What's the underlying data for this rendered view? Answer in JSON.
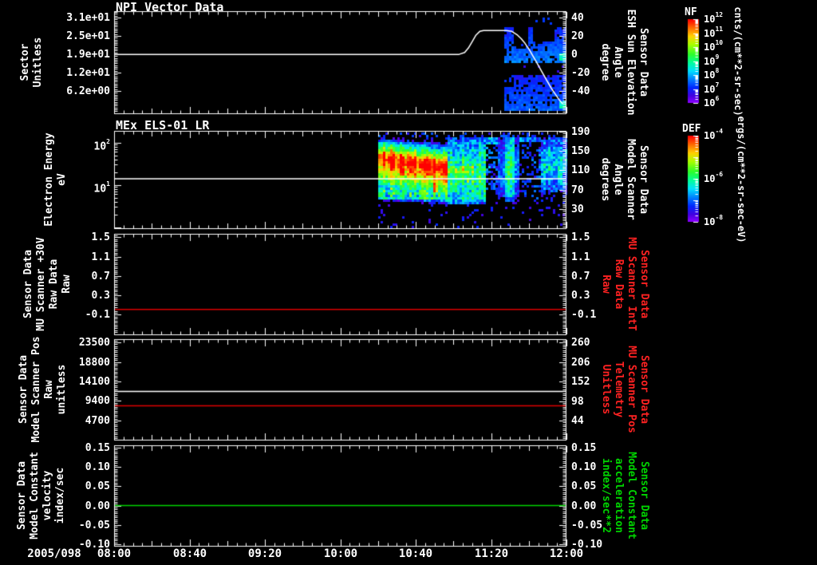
{
  "colors": {
    "background": "#000000",
    "foreground": "#ffffff",
    "red_accent": "#ff2222",
    "green_accent": "#00d400"
  },
  "chart_data": {
    "type": "heatmap",
    "description": "Five stacked time-series panels: NPI sector spectrogram with sun elevation line, MEx ELS-01 LR electron energy spectrogram, and three constant-value line panels",
    "date_label": "2005/098",
    "time_axis": {
      "tick_labels": [
        "08:00",
        "08:40",
        "09:20",
        "10:00",
        "10:40",
        "11:20",
        "12:00"
      ],
      "tick_minutes": [
        0,
        40,
        80,
        120,
        160,
        200,
        240
      ],
      "minor_step_min": 5,
      "mid_step_min": 20,
      "range_min": [
        0,
        240
      ]
    },
    "palette": [
      [
        0.0,
        "#ff0000"
      ],
      [
        0.1,
        "#ff6a00"
      ],
      [
        0.2,
        "#ffd000"
      ],
      [
        0.3,
        "#a8ff00"
      ],
      [
        0.42,
        "#2bff2b"
      ],
      [
        0.52,
        "#00ff99"
      ],
      [
        0.62,
        "#00e0ff"
      ],
      [
        0.72,
        "#0080ff"
      ],
      [
        0.82,
        "#0028ff"
      ],
      [
        0.92,
        "#4400e0"
      ],
      [
        1.0,
        "#8a00ff"
      ]
    ],
    "panels": [
      {
        "id": "npi-vector-data",
        "title": "NPI Vector Data",
        "left_label": "Sector\nUnitless",
        "right_label": "Sensor Data\nESH Sun Elevation\nAngle\ndegree",
        "left_axis": {
          "scale": "linear",
          "ylim": [
            -1.63,
            33.42
          ],
          "minor_step": 0.625,
          "ticks": [
            {
              "v": 31.25,
              "label": "3.1e+01"
            },
            {
              "v": 25.0,
              "label": "2.5e+01"
            },
            {
              "v": 18.75,
              "label": "1.9e+01"
            },
            {
              "v": 12.5,
              "label": "1.2e+01"
            },
            {
              "v": 6.25,
              "label": "6.2e+00"
            }
          ]
        },
        "right_axis": {
          "scale": "linear",
          "ylim": [
            -65,
            47
          ],
          "minor_step": 2,
          "ticks": [
            {
              "v": 40,
              "label": "40"
            },
            {
              "v": 20,
              "label": "20"
            },
            {
              "v": 0,
              "label": "0"
            },
            {
              "v": -20,
              "label": "-20"
            },
            {
              "v": -40,
              "label": "-40"
            }
          ]
        },
        "series": [
          {
            "name": "esh_sun_elevation_angle",
            "color": "#ffffff",
            "axis": "right",
            "points": [
              [
                0,
                0
              ],
              [
                183,
                0
              ],
              [
                186,
                2
              ],
              [
                188,
                7
              ],
              [
                190,
                14
              ],
              [
                192,
                21
              ],
              [
                194,
                25
              ],
              [
                196,
                26
              ],
              [
                208,
                26
              ],
              [
                211,
                25
              ],
              [
                214,
                21
              ],
              [
                216,
                17
              ],
              [
                218,
                12
              ],
              [
                220,
                6
              ],
              [
                222,
                -1
              ],
              [
                224,
                -8
              ],
              [
                227,
                -19
              ],
              [
                230,
                -30
              ],
              [
                232,
                -37
              ],
              [
                234,
                -43
              ],
              [
                236,
                -49
              ],
              [
                238,
                -54
              ]
            ]
          }
        ],
        "spectrogram": {
          "time_range_min": [
            207,
            240
          ],
          "bands": [
            {
              "top_frac": 0.135,
              "bottom_frac": 0.49
            },
            {
              "top_frac": 0.6,
              "bottom_frac": 0.965
            }
          ],
          "base_color": "#3c14d2",
          "highlight_color": "#00cfff"
        }
      },
      {
        "id": "mex-els-01-lr",
        "title": "MEx ELS-01 LR",
        "left_label": "Electron Energy\neV",
        "right_label": "Sensor Data\nModel Scanner\nAngle\ndegrees",
        "left_axis": {
          "scale": "log",
          "ylim": [
            0.9,
            190
          ],
          "ticks": [
            {
              "v": 100,
              "label": "10^2"
            },
            {
              "v": 10,
              "label": "10^1"
            }
          ]
        },
        "right_axis": {
          "scale": "linear",
          "ylim": [
            -11.6,
            191.6
          ],
          "minor_step": 4,
          "ticks": [
            {
              "v": 190,
              "label": "190"
            },
            {
              "v": 150,
              "label": "150"
            },
            {
              "v": 110,
              "label": "110"
            },
            {
              "v": 70,
              "label": "70"
            },
            {
              "v": 30,
              "label": "30"
            }
          ]
        },
        "series": [
          {
            "name": "energy_marker_14ev",
            "color": "#ffffff",
            "axis": "left",
            "points": [
              [
                0,
                14
              ],
              [
                240,
                14
              ]
            ]
          }
        ],
        "spectrogram": {
          "time_range_min": [
            140,
            240
          ],
          "energy_range_ev": [
            3.2,
            190
          ],
          "red_band": {
            "t_range": [
              140,
              176
            ],
            "center_ev_start": 46,
            "center_ev_end": 27
          },
          "red_streak_min": [
            168.5,
            171.5
          ],
          "gap_columns_min": [
            [
              197,
              203.5
            ],
            [
              214,
              226
            ]
          ],
          "bright_column_min": [
            206.5,
            211.5
          ],
          "right_patch_min": [
            226,
            240
          ]
        }
      },
      {
        "id": "mu-scanner-30v",
        "title": "",
        "left_label": "Sensor Data\nMU Scanner +30V\nRaw Data\nRaw",
        "right_label": "Sensor Data\nMU Scanner IntT\nRaw Data\nRaw",
        "right_label_color": "red",
        "left_axis": {
          "scale": "linear",
          "ylim": [
            -0.52,
            1.57
          ],
          "minor_step": 0.04,
          "ticks": [
            {
              "v": 1.5,
              "label": "1.5"
            },
            {
              "v": 1.1,
              "label": "1.1"
            },
            {
              "v": 0.7,
              "label": "0.7"
            },
            {
              "v": 0.3,
              "label": "0.3"
            },
            {
              "v": -0.1,
              "label": "-0.1"
            }
          ]
        },
        "right_axis": {
          "scale": "linear",
          "ylim": [
            -0.52,
            1.57
          ],
          "minor_step": 0.04,
          "ticks": [
            {
              "v": 1.5,
              "label": "1.5"
            },
            {
              "v": 1.1,
              "label": "1.1"
            },
            {
              "v": 0.7,
              "label": "0.7"
            },
            {
              "v": 0.3,
              "label": "0.3"
            },
            {
              "v": -0.1,
              "label": "-0.1"
            }
          ]
        },
        "series": [
          {
            "name": "mu_scanner_30v_raw",
            "color": "#dd0000",
            "axis": "left",
            "points": [
              [
                0,
                0.012
              ],
              [
                240,
                0.012
              ]
            ]
          }
        ]
      },
      {
        "id": "model-scanner-pos",
        "title": "",
        "left_label": "Sensor Data\nModel Scanner Pos\nRaw\nunitless",
        "right_label": "Sensor Data\nMU Scanner Pos\nTelemetry\nUnitless",
        "right_label_color": "red",
        "left_axis": {
          "scale": "linear",
          "ylim": [
            -100,
            24270
          ],
          "minor_step": 470,
          "ticks": [
            {
              "v": 23500,
              "label": "23500"
            },
            {
              "v": 18800,
              "label": "18800"
            },
            {
              "v": 14100,
              "label": "14100"
            },
            {
              "v": 9400,
              "label": "9400"
            },
            {
              "v": 4700,
              "label": "4700"
            }
          ]
        },
        "right_axis": {
          "scale": "linear",
          "ylim": [
            -11.2,
            269
          ],
          "minor_step": 5.4,
          "ticks": [
            {
              "v": 260,
              "label": "260"
            },
            {
              "v": 206,
              "label": "206"
            },
            {
              "v": 152,
              "label": "152"
            },
            {
              "v": 98,
              "label": "98"
            },
            {
              "v": 44,
              "label": "44"
            }
          ]
        },
        "series": [
          {
            "name": "model_scanner_pos_raw",
            "color": "#ffffff",
            "axis": "left",
            "points": [
              [
                0,
                11700
              ],
              [
                240,
                11700
              ]
            ]
          },
          {
            "name": "mu_scanner_pos_telemetry",
            "color": "#dd0000",
            "axis": "left",
            "points": [
              [
                0,
                8250
              ],
              [
                240,
                8250
              ]
            ]
          }
        ]
      },
      {
        "id": "model-constant",
        "title": "",
        "left_label": "Sensor Data\nModel Constant\nvelocity\nindex/sec",
        "right_label": "Sensor Data\nModel Constant\nacceleration\nindex/sec**2",
        "right_label_color": "green",
        "left_axis": {
          "scale": "linear",
          "ylim": [
            -0.106,
            0.156
          ],
          "minor_step": 0.005,
          "ticks": [
            {
              "v": 0.15,
              "label": "0.15"
            },
            {
              "v": 0.1,
              "label": "0.10"
            },
            {
              "v": 0.05,
              "label": "0.05"
            },
            {
              "v": 0.0,
              "label": "0.00"
            },
            {
              "v": -0.05,
              "label": "-0.05"
            },
            {
              "v": -0.1,
              "label": "-0.10"
            }
          ]
        },
        "right_axis": {
          "scale": "linear",
          "ylim": [
            -0.106,
            0.156
          ],
          "minor_step": 0.005,
          "ticks": [
            {
              "v": 0.15,
              "label": "0.15"
            },
            {
              "v": 0.1,
              "label": "0.10"
            },
            {
              "v": 0.05,
              "label": "0.05"
            },
            {
              "v": 0.0,
              "label": "0.00"
            },
            {
              "v": -0.05,
              "label": "-0.05"
            },
            {
              "v": -0.1,
              "label": "-0.10"
            }
          ]
        },
        "series": [
          {
            "name": "model_constant_velocity",
            "color": "#00d400",
            "axis": "left",
            "points": [
              [
                0,
                0.0
              ],
              [
                240,
                0.0
              ]
            ]
          }
        ]
      }
    ],
    "colorbars": [
      {
        "name": "NF",
        "unit": "cnts/(cm**2-sr-sec)",
        "log_range": [
          6,
          12
        ],
        "tick_labels": [
          "10^12",
          "10^11",
          "10^10",
          "10^9",
          "10^8",
          "10^7",
          "10^6"
        ]
      },
      {
        "name": "DEF",
        "unit": "ergs/(cm**2-sr-sec-eV)",
        "log_range": [
          -8,
          -4
        ],
        "tick_labels": [
          "10^-4",
          "10^-6",
          "10^-8"
        ]
      }
    ]
  }
}
